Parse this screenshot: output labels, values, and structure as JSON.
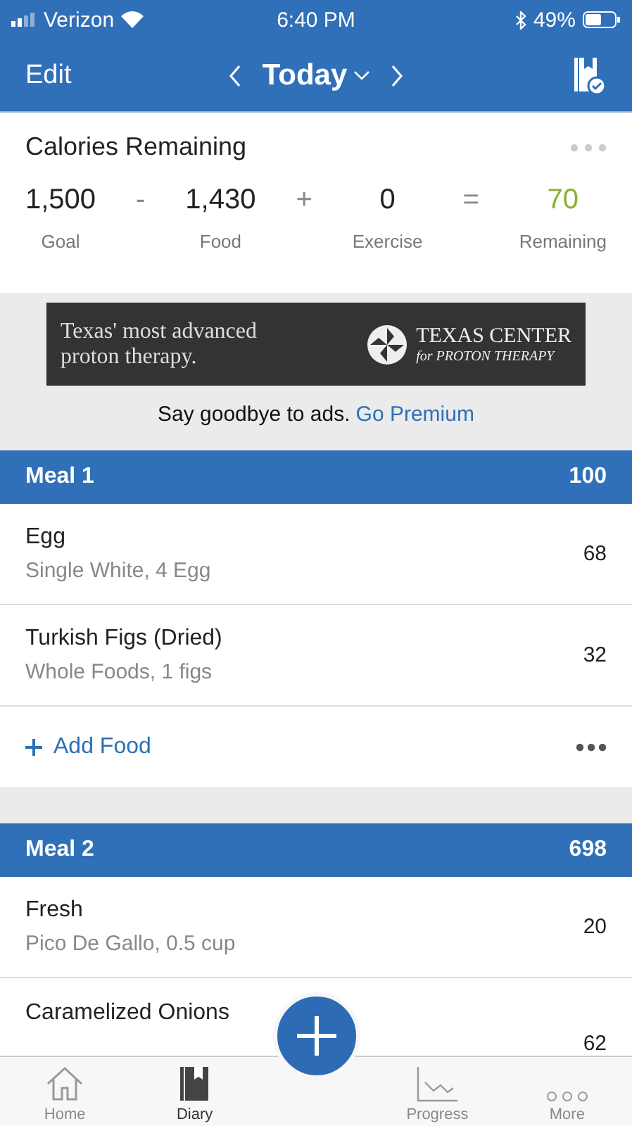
{
  "status_bar": {
    "carrier": "Verizon",
    "time": "6:40 PM",
    "battery": "49%"
  },
  "nav": {
    "edit": "Edit",
    "date": "Today"
  },
  "calories": {
    "title": "Calories Remaining",
    "items": [
      {
        "value": "1,500",
        "label": "Goal",
        "kind": "number"
      },
      {
        "value": "-",
        "kind": "operator"
      },
      {
        "value": "1,430",
        "label": "Food",
        "kind": "number"
      },
      {
        "value": "+",
        "kind": "operator"
      },
      {
        "value": "0",
        "label": "Exercise",
        "kind": "number"
      },
      {
        "value": "=",
        "kind": "operator"
      },
      {
        "value": "70",
        "label": "Remaining",
        "kind": "result"
      }
    ]
  },
  "ad": {
    "headline": "Texas' most advanced proton therapy.",
    "brand": "TEXAS CENTER",
    "brand_sub": "for PROTON THERAPY",
    "note": "Say goodbye to ads.",
    "link": "Go Premium"
  },
  "meals": [
    {
      "name": "Meal 1",
      "total": "100",
      "foods": [
        {
          "title": "Egg",
          "subtitle": "Single White, 4 Egg",
          "calories": "68"
        },
        {
          "title": "Turkish Figs (Dried)",
          "subtitle": "Whole Foods, 1 figs",
          "calories": "32"
        }
      ],
      "add": "Add Food"
    },
    {
      "name": "Meal 2",
      "total": "698",
      "foods": [
        {
          "title": "Fresh",
          "subtitle": "Pico De Gallo, 0.5 cup",
          "calories": "20"
        },
        {
          "title": "Caramelized Onions",
          "calories": "62"
        }
      ]
    }
  ],
  "tabs": [
    {
      "label": "Home",
      "kind": "home",
      "selected": false
    },
    {
      "label": "Diary",
      "kind": "diary",
      "selected": true
    },
    {
      "kind": "add",
      "selected": false
    },
    {
      "label": "Progress",
      "kind": "progress",
      "selected": false
    },
    {
      "label": "More",
      "kind": "more",
      "selected": false
    }
  ]
}
